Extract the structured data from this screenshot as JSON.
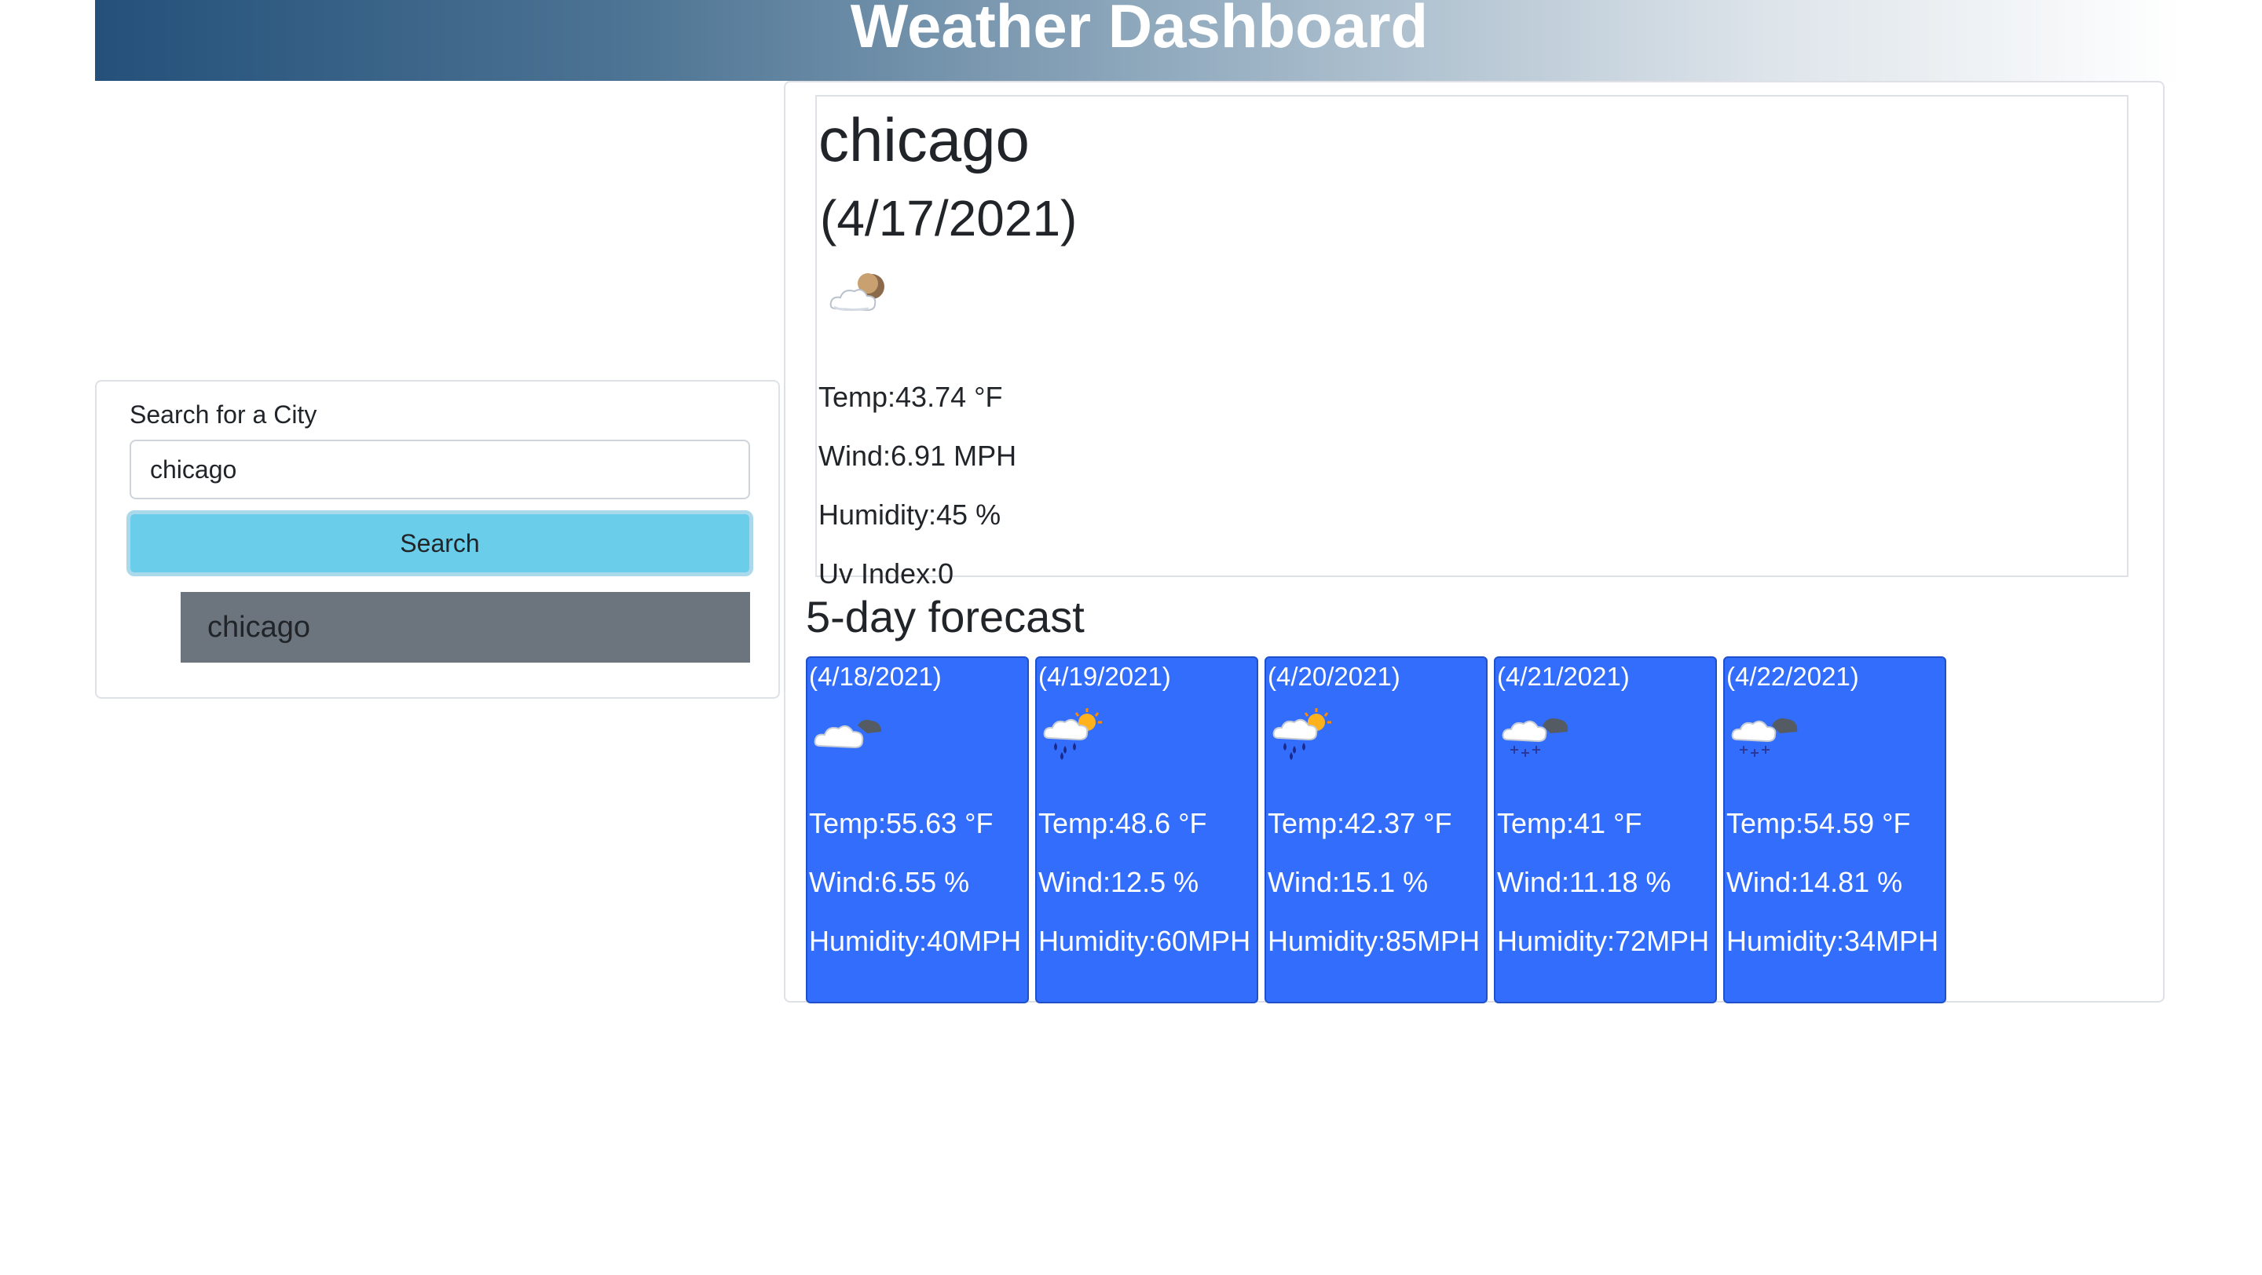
{
  "header": {
    "title": "Weather Dashboard"
  },
  "search": {
    "label": "Search for a City",
    "input_value": "chicago",
    "button_label": "Search",
    "history": [
      "chicago"
    ]
  },
  "current": {
    "city": "chicago",
    "date": "(4/17/2021)",
    "icon": "partly-cloudy-night-icon",
    "temp": "Temp:43.74 °F",
    "wind": "Wind:6.91 MPH",
    "humidity": "Humidity:45 %",
    "uv": "Uv Index:0"
  },
  "forecast": {
    "title": "5-day forecast",
    "days": [
      {
        "date": "(4/18/2021)",
        "icon": "cloud-icon",
        "temp": "Temp:55.63 °F",
        "wind": "Wind:6.55 %",
        "humidity": "Humidity:40MPH"
      },
      {
        "date": "(4/19/2021)",
        "icon": "rain-sun-icon",
        "temp": "Temp:48.6 °F",
        "wind": "Wind:12.5 %",
        "humidity": "Humidity:60MPH"
      },
      {
        "date": "(4/20/2021)",
        "icon": "rain-sun-icon",
        "temp": "Temp:42.37 °F",
        "wind": "Wind:15.1 %",
        "humidity": "Humidity:85MPH"
      },
      {
        "date": "(4/21/2021)",
        "icon": "snow-cloud-icon",
        "temp": "Temp:41 °F",
        "wind": "Wind:11.18 %",
        "humidity": "Humidity:72MPH"
      },
      {
        "date": "(4/22/2021)",
        "icon": "snow-cloud-icon",
        "temp": "Temp:54.59 °F",
        "wind": "Wind:14.81 %",
        "humidity": "Humidity:34MPH"
      }
    ]
  },
  "colors": {
    "header_start": "#24507a",
    "search_button": "#6acde9",
    "history_item": "#6c757d",
    "forecast_card": "#336dfc"
  }
}
